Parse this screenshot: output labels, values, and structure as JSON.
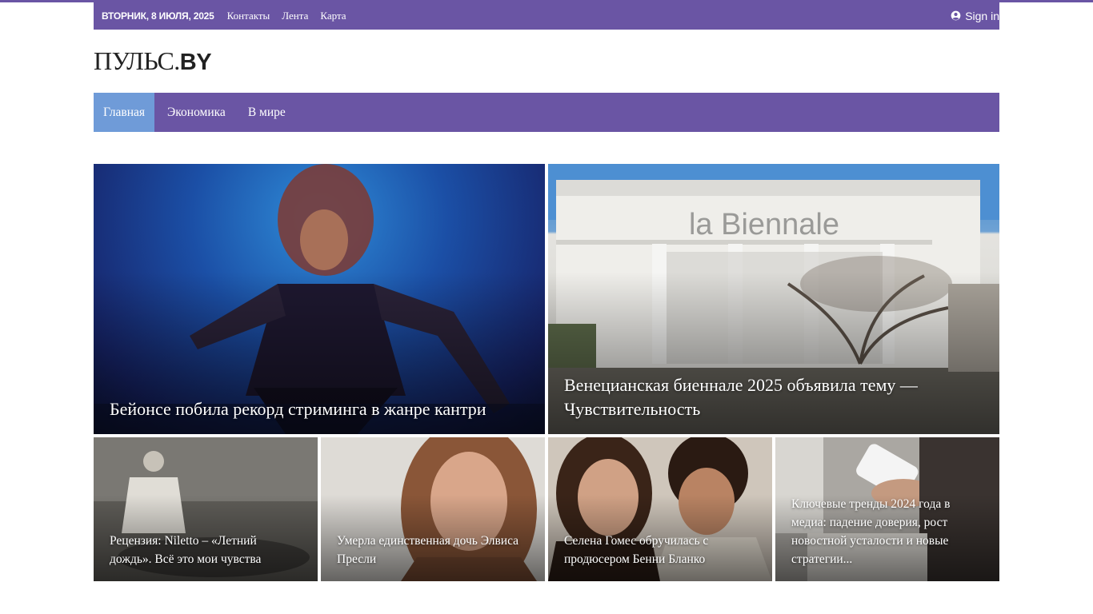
{
  "topbar": {
    "date": "ВТОРНИК, 8 ИЮЛЯ, 2025",
    "links": [
      "Контакты",
      "Лента",
      "Карта"
    ],
    "signin": "Sign in"
  },
  "logo": {
    "part1": "ПУЛЬС.",
    "part2": "BY"
  },
  "nav": {
    "items": [
      "Главная",
      "Экономика",
      "В мире"
    ],
    "active": "Главная"
  },
  "featured": [
    {
      "title": "Бейонсе побила рекорд стриминга в жанре кантри"
    },
    {
      "title": "Венецианская биеннале 2025 объявила тему — Чувствительность",
      "image_text": "la Biennale"
    }
  ],
  "tiles": [
    {
      "title": "Рецензия: Niletto – «Летний дождь». Всё это мои чувства"
    },
    {
      "title": "Умерла единственная дочь Элвиса Пресли"
    },
    {
      "title": "Селена Гомес обручилась с продюсером Бенни Бланко"
    },
    {
      "title": "Ключевые тренды 2024 года в медиа: падение доверия, рост новостной усталости и новые стратегии..."
    }
  ],
  "colors": {
    "brand": "#6a55a4",
    "nav_active": "#6f9bd8"
  },
  "icons": {
    "signin": "user-circle-icon"
  }
}
